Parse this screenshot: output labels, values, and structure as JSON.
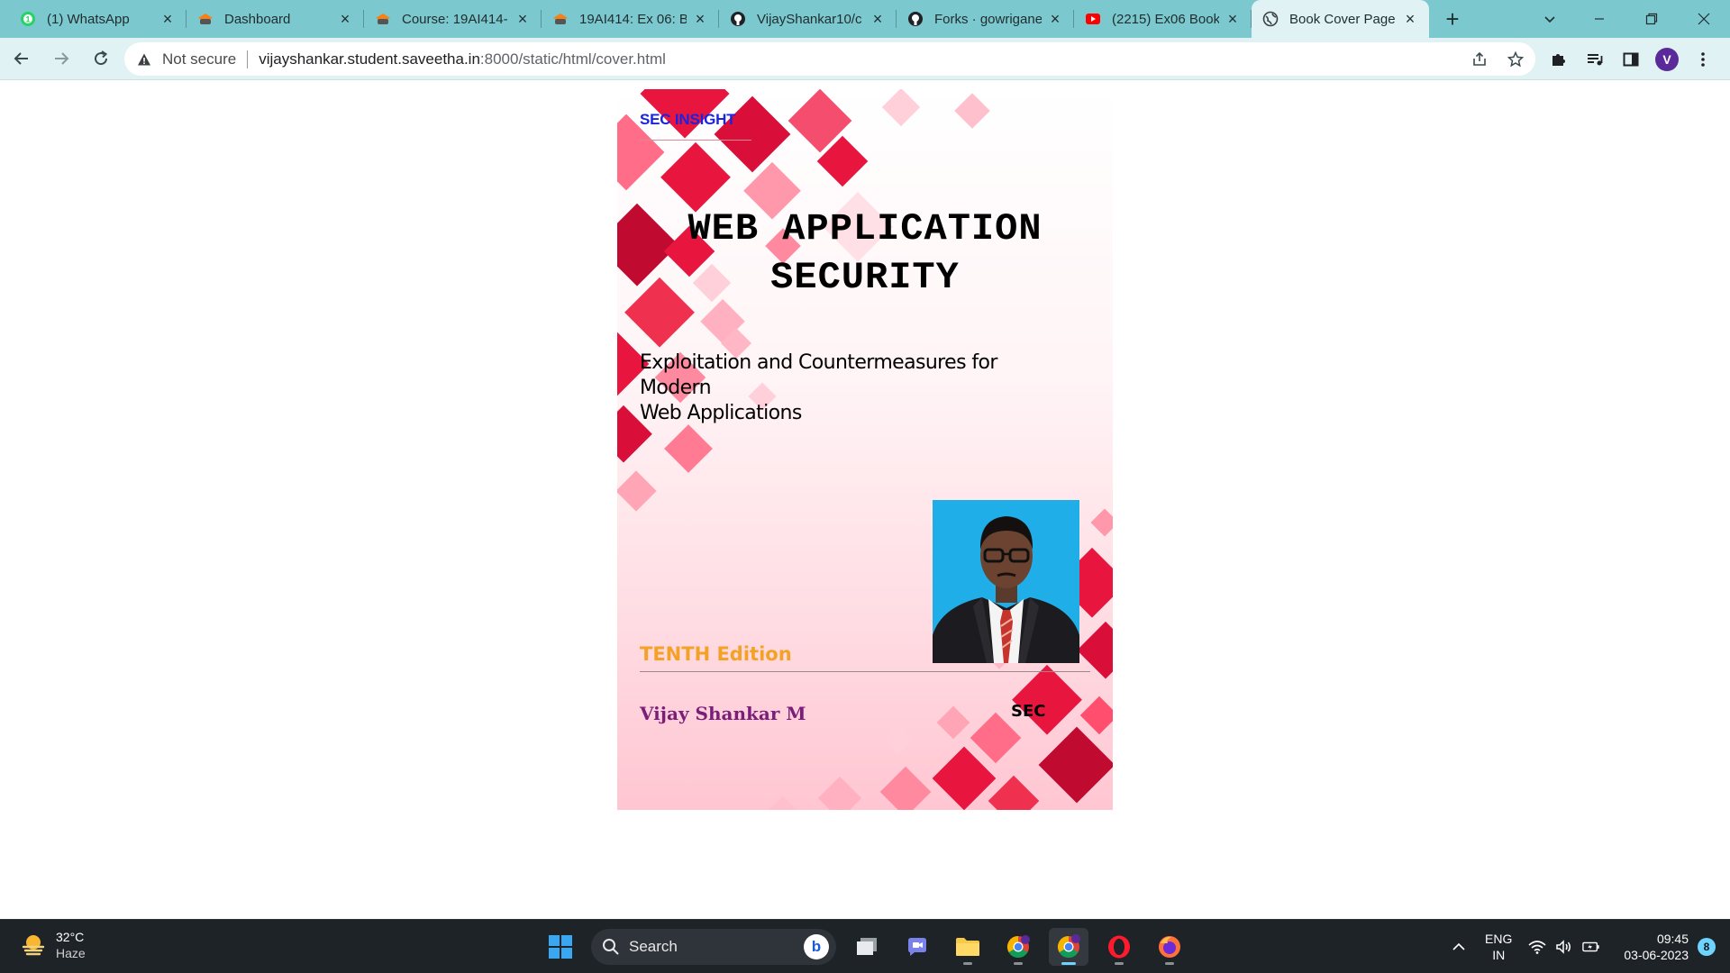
{
  "browser": {
    "tabs": [
      {
        "title": "(1) WhatsApp",
        "icon": "whatsapp-icon"
      },
      {
        "title": "Dashboard",
        "icon": "moodle-icon"
      },
      {
        "title": "Course: 19AI414-",
        "icon": "moodle-icon"
      },
      {
        "title": "19AI414: Ex 06: B",
        "icon": "moodle-icon"
      },
      {
        "title": "VijayShankar10/c",
        "icon": "github-icon"
      },
      {
        "title": "Forks · gowrigane",
        "icon": "github-icon"
      },
      {
        "title": "(2215) Ex06 Book",
        "icon": "youtube-icon"
      },
      {
        "title": "Book Cover Page",
        "icon": "globe-icon",
        "active": true
      }
    ],
    "address": {
      "security_label": "Not secure",
      "host": "vijayshankar.student.saveetha.in",
      "path": ":8000/static/html/cover.html"
    },
    "profile_initial": "V"
  },
  "cover": {
    "series": "SEC INSIGHT",
    "title_line1": "WEB APPLICATION",
    "title_line2": "SECURITY",
    "subtitle_line1": "Exploitation and Countermeasures for Modern",
    "subtitle_line2": "Web Applications",
    "edition": "TENTH Edition",
    "author": "Vijay Shankar M",
    "publisher": "SEC"
  },
  "taskbar": {
    "weather_temp": "32°C",
    "weather_desc": "Haze",
    "search_placeholder": "Search",
    "lang_line1": "ENG",
    "lang_line2": "IN",
    "time": "09:45",
    "date": "03-06-2023",
    "notification_count": "8"
  },
  "colors": {
    "tabstrip": "#7cc8cf",
    "toolbar": "#e0f2f4",
    "series_blue": "#1a23e0",
    "edition_orange": "#f4a226",
    "author_purple": "#7a1e79",
    "photo_bg": "#1faee8"
  }
}
